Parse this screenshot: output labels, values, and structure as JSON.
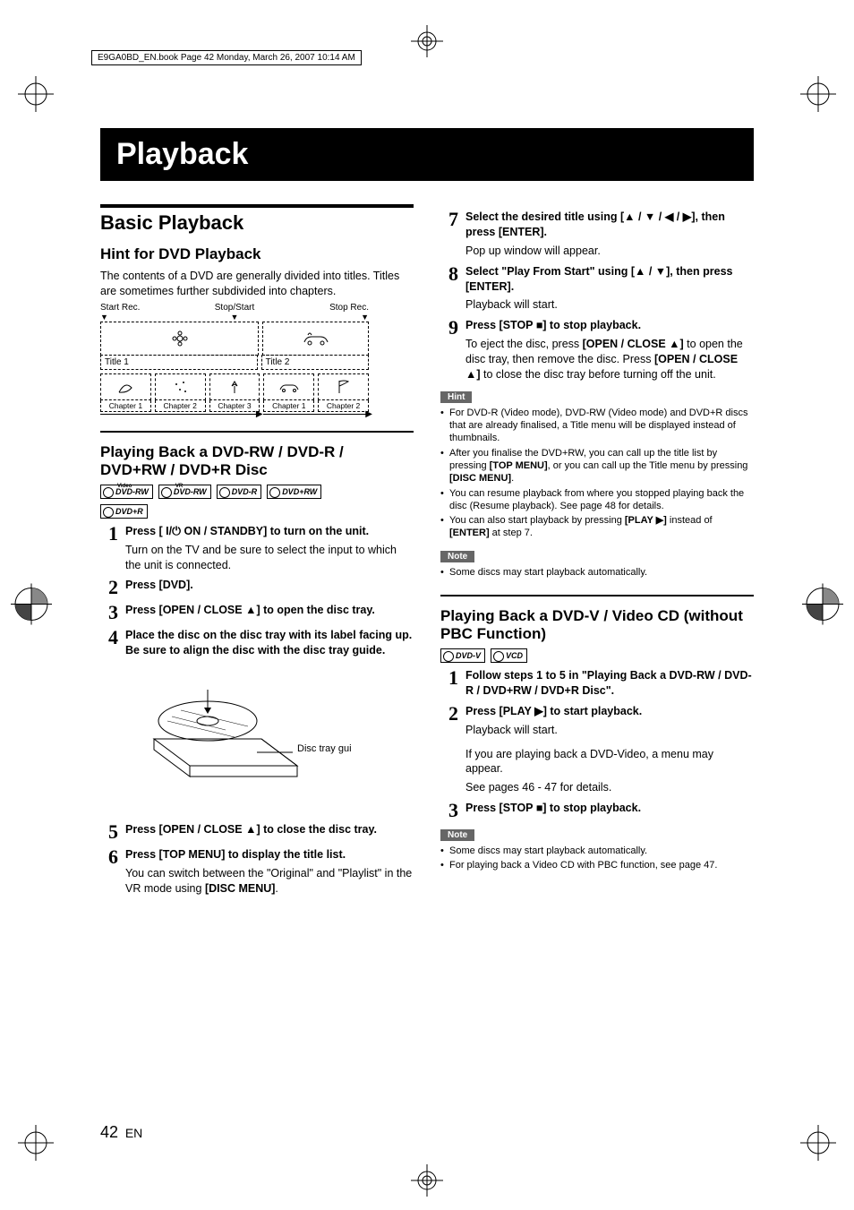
{
  "book_tag": "E9GA0BD_EN.book  Page 42  Monday, March 26, 2007  10:14 AM",
  "chapter_title": "Playback",
  "section_title": "Basic Playback",
  "hint_heading": "Hint for DVD Playback",
  "hint_body": "The contents of a DVD are generally divided into titles. Titles are sometimes further subdivided into chapters.",
  "dia": {
    "start_rec": "Start Rec.",
    "stop_start": "Stop/Start",
    "stop_rec": "Stop Rec.",
    "title1": "Title 1",
    "title2": "Title 2",
    "ch1": "Chapter 1",
    "ch2": "Chapter 2",
    "ch3": "Chapter 3",
    "ch1b": "Chapter 1",
    "ch2b": "Chapter 2"
  },
  "play_rw_heading": "Playing Back a DVD-RW / DVD-R / DVD+RW / DVD+R Disc",
  "disc_labels": {
    "rw_video": "DVD-RW",
    "rw_video_over": "Video",
    "rw_vr": "DVD-RW",
    "rw_vr_over": "VR",
    "dvdr": "DVD-R",
    "dvdprw": "DVD+RW",
    "dvdpr": "DVD+R",
    "dvdv": "DVD-V",
    "vcd": "VCD"
  },
  "steps_left": [
    {
      "n": "1",
      "lead": "Press [ I/⏻ ON / STANDBY] to turn on the unit.",
      "sub": "Turn on the TV and be sure to select the input to which the unit is connected."
    },
    {
      "n": "2",
      "lead": "Press [DVD]."
    },
    {
      "n": "3",
      "lead": "Press [OPEN / CLOSE ▲] to open the disc tray."
    },
    {
      "n": "4",
      "lead": "Place the disc on the disc tray with its label facing up. Be sure to align the disc with the disc tray guide."
    },
    {
      "n": "5",
      "lead": "Press [OPEN / CLOSE ▲] to close the disc tray."
    },
    {
      "n": "6",
      "lead": "Press [TOP MENU] to display the title list.",
      "sub_html": "You can switch between the \"Original\" and \"Playlist\" in the VR mode using <b>[DISC MENU]</b>."
    }
  ],
  "disc_tray_guide": "Disc tray guide",
  "steps_right": [
    {
      "n": "7",
      "lead": "Select the desired title using [▲ / ▼ / ◀ / ▶], then press [ENTER].",
      "sub": "Pop up window will appear."
    },
    {
      "n": "8",
      "lead": "Select \"Play From Start\" using [▲ / ▼], then press [ENTER].",
      "sub": "Playback will start."
    },
    {
      "n": "9",
      "lead": "Press [STOP ■] to stop playback.",
      "sub_html": "To eject the disc, press <b>[OPEN / CLOSE ▲]</b> to open the disc tray, then remove the disc. Press <b>[OPEN / CLOSE ▲]</b> to close the disc tray before turning off the unit."
    }
  ],
  "hint_label": "Hint",
  "hints": [
    "For DVD-R (Video mode), DVD-RW (Video mode) and DVD+R discs that are already finalised, a Title menu will be displayed instead of thumbnails.",
    "After you finalise the DVD+RW, you can call up the title list by pressing <b>[TOP MENU]</b>, or you can call up the Title menu by pressing <b>[DISC MENU]</b>.",
    "You can resume playback from where you stopped playing back the disc (Resume playback). See page 48 for details.",
    "You can also start playback by pressing <b>[PLAY ▶]</b> instead of <b>[ENTER]</b> at step 7."
  ],
  "note_label": "Note",
  "notes1": [
    "Some discs may start playback automatically."
  ],
  "play_v_heading": "Playing Back a DVD-V / Video CD (without PBC Function)",
  "steps_v": [
    {
      "n": "1",
      "lead": "Follow steps 1 to 5 in \"Playing Back a DVD-RW / DVD-R / DVD+RW / DVD+R Disc\"."
    },
    {
      "n": "2",
      "lead": "Press [PLAY ▶] to start playback.",
      "sub": "Playback will start.",
      "sub2": "If you are playing back a DVD-Video, a menu may appear.",
      "sub3": "See pages 46 - 47 for details."
    },
    {
      "n": "3",
      "lead": "Press [STOP ■] to stop playback."
    }
  ],
  "notes2": [
    "Some discs may start playback automatically.",
    "For playing back a Video CD with PBC function, see page 47."
  ],
  "page_number": "42",
  "page_lang": "EN"
}
